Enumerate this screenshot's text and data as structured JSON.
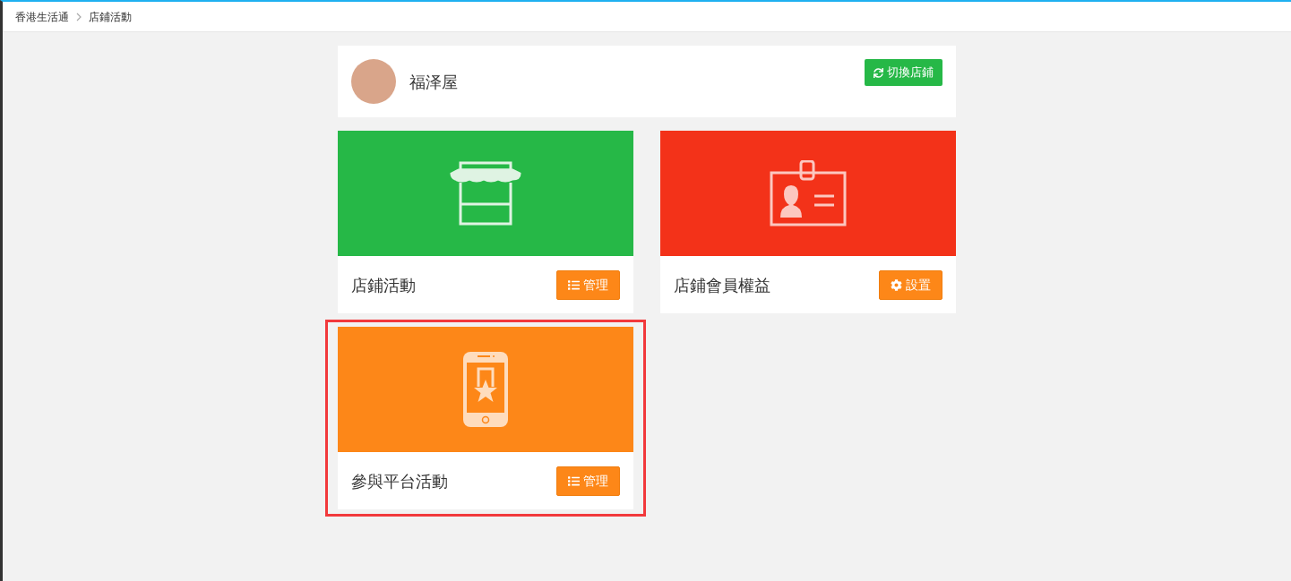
{
  "breadcrumb": [
    {
      "label": "香港生活通"
    },
    {
      "label": "店鋪活動"
    }
  ],
  "store": {
    "name": "福泽屋",
    "switch_button": "切換店鋪"
  },
  "cards": [
    {
      "kind": "store",
      "title": "店鋪活動",
      "color": "#26b847",
      "button": {
        "kind": "list",
        "label": "管理"
      },
      "highlighted": false
    },
    {
      "kind": "member-card",
      "title": "店鋪會員權益",
      "color": "#f33219",
      "button": {
        "kind": "gear",
        "label": "設置"
      },
      "highlighted": false
    },
    {
      "kind": "phone-star",
      "title": "參與平台活動",
      "color": "#fd8718",
      "button": {
        "kind": "list",
        "label": "管理"
      },
      "highlighted": true
    }
  ]
}
